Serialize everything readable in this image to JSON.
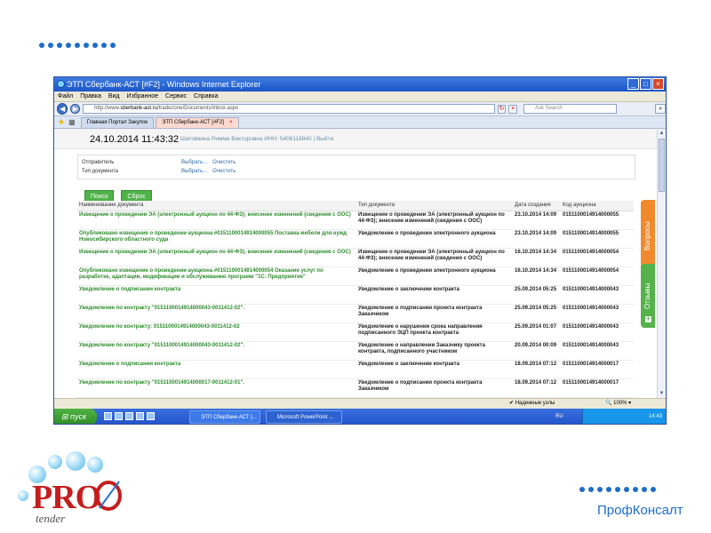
{
  "slide": {
    "brand_text": "ПрофКонсалт",
    "logo_text": "PRO",
    "logo_sub": "tender"
  },
  "window": {
    "title": "ЭТП Сбербанк-АСТ [#F2] - Windows Internet Explorer",
    "menu": [
      "Файл",
      "Правка",
      "Вид",
      "Избранное",
      "Сервис",
      "Справка"
    ],
    "address_prefix": "http://www.",
    "address_host": "sberbank-ast.ru",
    "address_path": "/tradezone/Documents/Inbox.aspx",
    "search_placeholder": "Ask Search",
    "tabs": [
      {
        "label": "Главная Портал Закупок",
        "active": false
      },
      {
        "label": "ЭТП Сбербанк-АСТ [#F2]",
        "active": true
      }
    ]
  },
  "page": {
    "datetime": "24.10.2014 11:43:32",
    "user_line": "Шатовкина Римма Викторовна ИНН: 5406118840 | Выйти",
    "filters": [
      {
        "label": "Отправитель",
        "select": "Выбрать...",
        "clear": "Очистить"
      },
      {
        "label": "Тип документа",
        "select": "Выбрать...",
        "clear": "Очистить"
      }
    ],
    "search_button": "Поиск",
    "reset_button": "Сброс",
    "table": {
      "headers": [
        "Наименование документа",
        "Тип документа",
        "Дата создания",
        "Код аукциона"
      ],
      "rows": [
        [
          "Извещение о проведении ЭА (электронный аукцион по 44-ФЗ); внесение изменений (сведения с ООС)",
          "Извещение о проведении ЭА (электронный аукцион по 44-ФЗ); внесение изменений (сведения с ООС)",
          "23.10.2014 14:09",
          "0151100014914000055"
        ],
        [
          "Опубликовано извещение о проведении аукциона #0151100014914000055 Поставка мебели для нужд Новосибирского областного суда",
          "Уведомление о проведении электронного аукциона",
          "23.10.2014 14:09",
          "0151100014914000055"
        ],
        [
          "Извещение о проведении ЭА (электронный аукцион по 44-ФЗ); внесение изменений (сведения с ООС)",
          "Извещение о проведении ЭА (электронный аукцион по 44-ФЗ); внесение изменений (сведения с ООС)",
          "16.10.2014 14:34",
          "0151100014914000054"
        ],
        [
          "Опубликовано извещение о проведении аукциона #0151100014914000054 Оказание услуг по разработке, адаптации, модификации и обслуживанию программ \"1С: Предприятие\"",
          "Уведомление о проведении электронного аукциона",
          "16.10.2014 14:34",
          "0151100014914000054"
        ],
        [
          "Уведомление о подписании контракта",
          "Уведомление о заключении контракта",
          "25.09.2014 05:25",
          "0151100014914000043"
        ],
        [
          "Уведомление по контракту \"0151100014914000043-0011412-02\".",
          "Уведомление о подписании проекта контракта Заказчиком",
          "25.09.2014 05:25",
          "0151100014914000043"
        ],
        [
          "Уведомление по контракту: 0151100014914000043-0011412-02",
          "Уведомление о нарушении срока направления подписанного ЭЦП проекта контракта",
          "25.09.2014 01:07",
          "0151100014914000043"
        ],
        [
          "Уведомление по контракту \"0151100014914000043-0011412-02\".",
          "Уведомление о направлении Заказчику проекта контракта, подписанного участником",
          "20.09.2014 00:09",
          "0151100014914000043"
        ],
        [
          "Уведомление о подписании контракта",
          "Уведомление о заключении контракта",
          "18.09.2014 07:12",
          "0151100014914000017"
        ],
        [
          "Уведомление по контракту \"0151100014914000017-0011412-01\".",
          "Уведомление о подписании проекта контракта Заказчиком",
          "18.09.2014 07:12",
          "0151100014914000017"
        ]
      ]
    },
    "side_tab_questions": "Вопросы",
    "side_tab_reviews": "Отзывы"
  },
  "status": {
    "safe_nodes": "Надежные узлы",
    "zoom": "100%"
  },
  "taskbar": {
    "start": "пуск",
    "items": [
      "ЭТП Сбербанк-АСТ [...",
      "Microsoft PowerPoint ..."
    ],
    "lang": "RU",
    "clock": "14:43"
  }
}
